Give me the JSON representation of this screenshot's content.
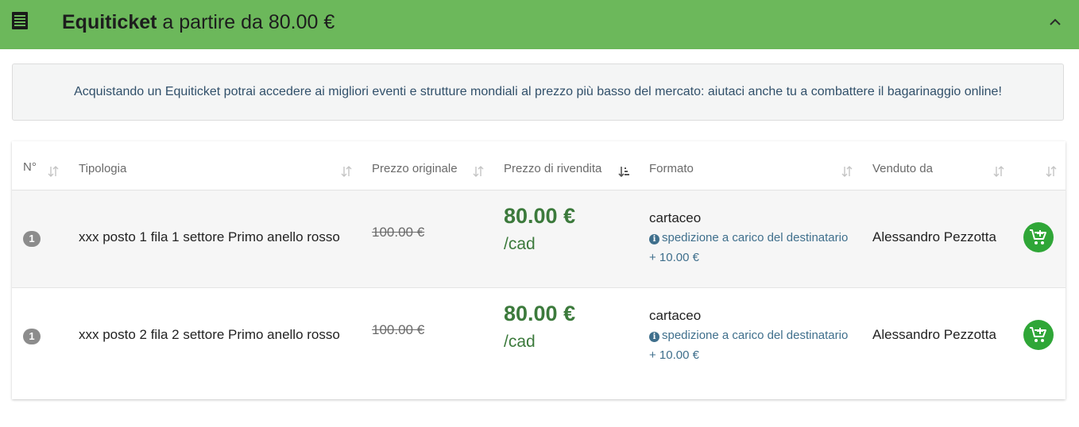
{
  "header": {
    "title_bold": "Equiticket",
    "title_rest": " a partire da 80.00 €",
    "icon": "ticket-icon",
    "collapse_icon": "chevron-up-icon"
  },
  "info": {
    "text": "Acquistando un Equiticket potrai accedere ai migliori eventi e strutture mondiali al prezzo più basso del mercato: aiutaci anche tu a combattere il bagarinaggio online!"
  },
  "table": {
    "headers": [
      "N°",
      "Tipologia",
      "Prezzo originale",
      "Prezzo di rivendita",
      "Formato",
      "Venduto da"
    ],
    "rows": [
      {
        "n": "1",
        "tipologia": "xxx posto 1 fila 1 settore Primo anello rosso",
        "prezzo_originale": "100.00 €",
        "prezzo_rivendita": "80.00 €",
        "unit": "/cad",
        "formato": "cartaceo",
        "spedizione": "spedizione a carico del destinatario",
        "spedizione_costo": "+ 10.00 €",
        "venduto_da": "Alessandro Pezzotta"
      },
      {
        "n": "1",
        "tipologia": "xxx posto 2 fila 2 settore Primo anello rosso",
        "prezzo_originale": "100.00 €",
        "prezzo_rivendita": "80.00 €",
        "unit": "/cad",
        "formato": "cartaceo",
        "spedizione": "spedizione a carico del destinatario",
        "spedizione_costo": "+ 10.00 €",
        "venduto_da": "Alessandro Pezzotta"
      }
    ]
  },
  "colors": {
    "header_bg": "#6cb85b",
    "price_green": "#3c7a3c",
    "cart_green": "#2fa637",
    "link_blue": "#3f6f8c"
  }
}
